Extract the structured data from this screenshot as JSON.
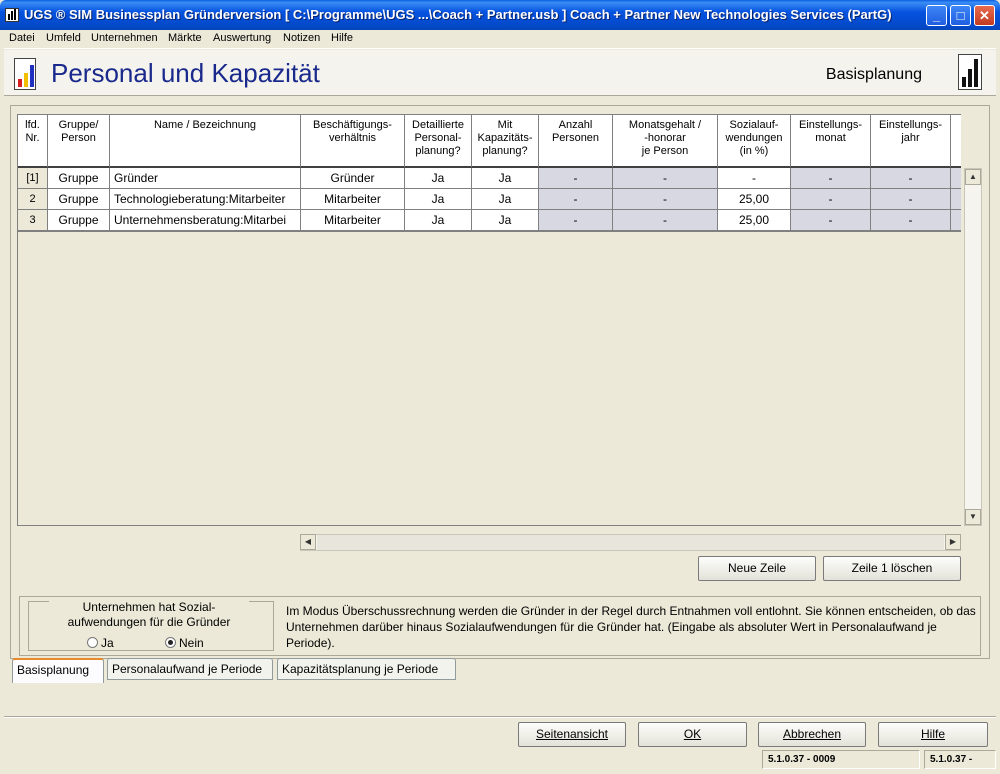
{
  "window": {
    "title": "UGS ® SIM Businessplan Gründerversion   [ C:\\Programme\\UGS ...\\Coach + Partner.usb ] Coach + Partner New Technologies Services (PartG)",
    "minimize": "_",
    "maximize": "□",
    "close": "✕"
  },
  "menu": [
    "Datei",
    "Umfeld",
    "Unternehmen",
    "Märkte",
    "Auswertung",
    "Notizen",
    "Hilfe"
  ],
  "header": {
    "title": "Personal und Kapazität",
    "mode": "Basisplanung"
  },
  "table": {
    "columns": [
      "lfd.\nNr.",
      "Gruppe/\nPerson",
      "Name / Bezeichnung",
      "Beschäftigungs-\nverhältnis",
      "Detaillierte\nPersonal-\nplanung?",
      "Mit\nKapazitäts-\nplanung?",
      "Anzahl\nPersonen",
      "Monatsgehalt /\n-honorar\nje Person",
      "Sozialauf-\nwendungen\n(in %)",
      "Einstellungs-\nmonat",
      "Einstellungs-\njahr"
    ],
    "rows": [
      [
        "[1]",
        "Gruppe",
        "Gründer",
        "Gründer",
        "Ja",
        "Ja",
        "-",
        "-",
        "-",
        "-",
        "-"
      ],
      [
        "2",
        "Gruppe",
        "Technologieberatung:Mitarbeiter",
        "Mitarbeiter",
        "Ja",
        "Ja",
        "-",
        "-",
        "25,00",
        "-",
        "-"
      ],
      [
        "3",
        "Gruppe",
        "Unternehmensberatung:Mitarbei",
        "Mitarbeiter",
        "Ja",
        "Ja",
        "-",
        "-",
        "25,00",
        "-",
        "-"
      ]
    ]
  },
  "buttons": {
    "new_row": "Neue Zeile",
    "delete_row": "Zeile 1 löschen",
    "preview": "Seitenansicht",
    "ok": "OK",
    "cancel": "Abbrechen",
    "help": "Hilfe"
  },
  "social": {
    "title": "Unternehmen hat Sozial-\naufwendungen für die Gründer",
    "option_yes": "Ja",
    "option_no": "Nein",
    "selected": "Nein",
    "info": "Im Modus Überschussrechnung  werden die Gründer in der Regel durch Entnahmen voll entlohnt. Sie können entscheiden, ob das Unternehmen darüber hinaus Sozialaufwendungen für die Gründer hat. (Eingabe als absoluter Wert in Personalaufwand je Periode)."
  },
  "tabs": [
    "Basisplanung",
    "Personalaufwand je Periode",
    "Kapazitätsplanung je Periode"
  ],
  "status": {
    "version": "5.1.0.37 - 0009",
    "version_short": "5.1.0.37 -"
  }
}
